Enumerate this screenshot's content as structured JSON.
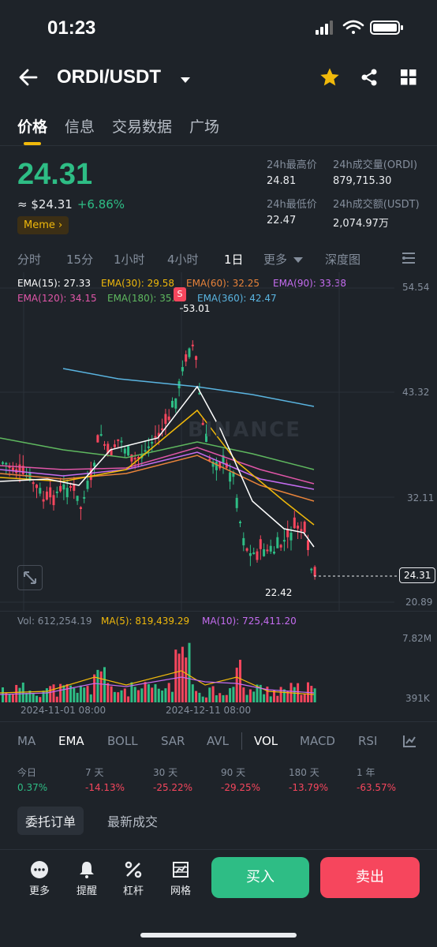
{
  "status": {
    "time": "01:23"
  },
  "header": {
    "pair": "ORDI/USDT"
  },
  "tabs": [
    {
      "label": "价格"
    },
    {
      "label": "信息"
    },
    {
      "label": "交易数据"
    },
    {
      "label": "广场"
    }
  ],
  "price": {
    "last": "24.31",
    "approx": "≈ $24.31",
    "change": "+6.86%",
    "tag": "Meme"
  },
  "stats": {
    "high_label": "24h最高价",
    "high": "24.81",
    "low_label": "24h最低价",
    "low": "22.47",
    "vol_label": "24h成交量(ORDI)",
    "vol": "879,715.30",
    "amt_label": "24h成交额(USDT)",
    "amt": "2,074.97万"
  },
  "timeframes": [
    "分时",
    "15分",
    "1小时",
    "4小时",
    "1日",
    "更多",
    "深度图"
  ],
  "ema_legend": {
    "ema15": "EMA(15): 27.33",
    "ema30": "EMA(30): 29.58",
    "ema60": "EMA(60): 32.25",
    "ema90": "EMA(90): 33.38",
    "ema120": "EMA(120): 34.15",
    "ema180": "EMA(180): 35.",
    "ema360": "EMA(360): 42.47"
  },
  "colors": {
    "up": "#2ebd85",
    "down": "#f6465d",
    "accent": "#f0b90b",
    "ema15": "#ffffff",
    "ema30": "#f0b90b",
    "ema60": "#e8833a",
    "ema90": "#c56cf0",
    "ema120": "#e056a8",
    "ema180": "#5fb85f",
    "ema360": "#5ab4e0"
  },
  "chart_axis": {
    "y_top": "54.54",
    "y_2": "43.32",
    "y_3": "32.11",
    "y_bottom": "20.89",
    "current": "24.31",
    "max_label": "53.01",
    "min_label": "22.42",
    "watermark": "BINANCE",
    "sell_marker": "S"
  },
  "volume": {
    "vol": "Vol: 612,254.19",
    "ma5": "MA(5): 819,439.29",
    "ma10": "MA(10): 725,411.20",
    "y_top": "7.82M",
    "y_bottom": "391K",
    "date1": "2024-11-01 08:00",
    "date2": "2024-12-11 08:00"
  },
  "indicators": [
    "MA",
    "EMA",
    "BOLL",
    "SAR",
    "AVL",
    "VOL",
    "MACD",
    "RSI"
  ],
  "performance": [
    {
      "label": "今日",
      "value": "0.37%"
    },
    {
      "label": "7 天",
      "value": "-14.13%"
    },
    {
      "label": "30 天",
      "value": "-25.22%"
    },
    {
      "label": "90 天",
      "value": "-29.25%"
    },
    {
      "label": "180 天",
      "value": "-13.79%"
    },
    {
      "label": "1 年",
      "value": "-63.57%"
    }
  ],
  "orders": {
    "tab1": "委托订单",
    "tab2": "最新成交"
  },
  "bottom": {
    "more": "更多",
    "alert": "提醒",
    "leverage": "杠杆",
    "grid": "网格",
    "buy": "买入",
    "sell": "卖出"
  },
  "icons": [
    "signal-icon",
    "wifi-icon",
    "battery-icon",
    "back-arrow-icon",
    "dropdown-icon",
    "star-icon",
    "share-icon",
    "grid-icon",
    "settings-icon",
    "expand-icon",
    "chart-settings-icon",
    "more-dots-icon",
    "bell-icon",
    "leverage-icon",
    "grid-trade-icon"
  ]
}
